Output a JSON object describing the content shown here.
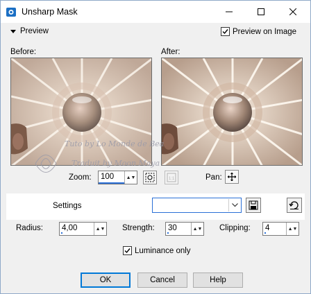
{
  "window": {
    "title": "Unsharp Mask",
    "app_icon": "psp-icon",
    "controls": [
      "minimize-icon",
      "maximize-icon",
      "close-icon"
    ]
  },
  "preview": {
    "toggle_label": "Preview",
    "checkbox_label": "Preview on Image",
    "checkbox_checked": true,
    "before_label": "Before:",
    "after_label": "After:"
  },
  "zoom": {
    "label": "Zoom:",
    "value": "100"
  },
  "pan": {
    "label": "Pan:"
  },
  "settings": {
    "label": "Settings",
    "value": ""
  },
  "params": {
    "radius_label": "Radius:",
    "radius_value": "4,00",
    "strength_label": "Strength:",
    "strength_value": "30",
    "clipping_label": "Clipping:",
    "clipping_value": "4"
  },
  "luminance": {
    "label": "Luminance only",
    "checked": true
  },
  "buttons": {
    "ok": "OK",
    "cancel": "Cancel",
    "help": "Help"
  },
  "watermark": {
    "line1": "Tuto by Lo Monde de Bea",
    "line2": "Traduit by Moon Maya"
  },
  "colors": {
    "accent": "#2a6fd6",
    "preview_tone": "#d9c7b6"
  }
}
